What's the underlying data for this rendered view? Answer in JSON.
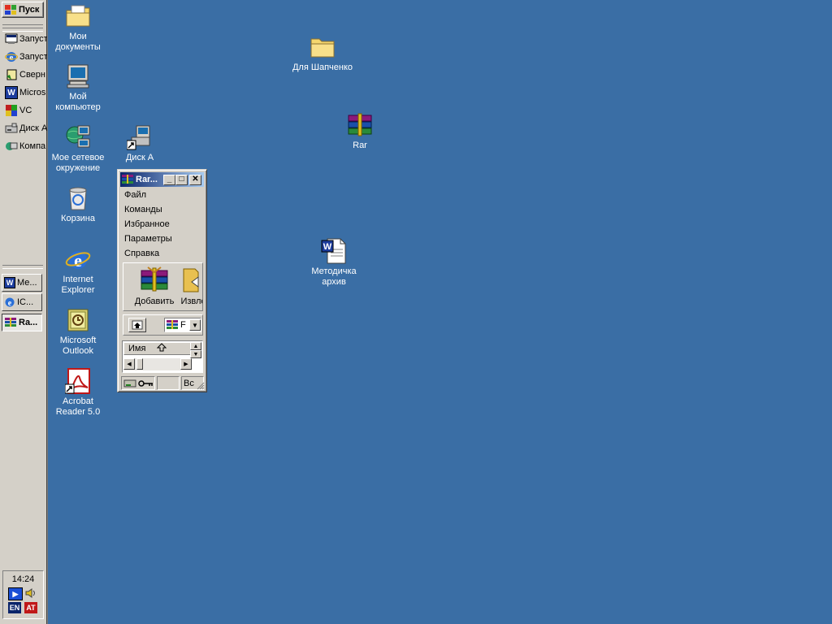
{
  "taskbar": {
    "start_label": "Пуск",
    "quick_launch": [
      {
        "label": "Запуст",
        "icon": "show-desktop-icon"
      },
      {
        "label": "Запуст",
        "icon": "internet-explorer-icon"
      },
      {
        "label": "Сверн",
        "icon": "minimize-windows-icon"
      },
      {
        "label": "Micros",
        "icon": "word-icon"
      },
      {
        "label": "VC",
        "icon": "vc-icon"
      },
      {
        "label": "Диск А",
        "icon": "floppy-icon"
      },
      {
        "label": "Компа",
        "icon": "computer-icon"
      }
    ],
    "tasks": [
      {
        "label": "Ме...",
        "icon": "word-icon",
        "active": false
      },
      {
        "label": "IC...",
        "icon": "internet-explorer-icon",
        "active": false
      },
      {
        "label": "Ra...",
        "icon": "winrar-icon",
        "active": true
      }
    ],
    "clock": "14:24",
    "tray": [
      {
        "name": "media-player-icon",
        "text": "▶"
      },
      {
        "name": "volume-icon",
        "text": "🔈"
      },
      {
        "name": "language-indicator",
        "text": "EN"
      },
      {
        "name": "ati-icon",
        "text": "AT"
      }
    ]
  },
  "desktop_icons": [
    {
      "id": "my-documents",
      "label": "Мои документы",
      "icon": "folder-documents-icon"
    },
    {
      "id": "my-computer",
      "label": "Мой компьютер",
      "icon": "computer-icon"
    },
    {
      "id": "network",
      "label": "Мое сетевое окружение",
      "icon": "network-icon"
    },
    {
      "id": "disk-a",
      "label": "Диск А",
      "icon": "floppy-shortcut-icon"
    },
    {
      "id": "recycle-bin",
      "label": "Корзина",
      "icon": "recycle-bin-icon"
    },
    {
      "id": "internet-explorer",
      "label": "Internet Explorer",
      "icon": "internet-explorer-icon"
    },
    {
      "id": "outlook",
      "label": "Microsoft Outlook",
      "icon": "outlook-icon"
    },
    {
      "id": "acrobat",
      "label": "Acrobat Reader 5.0",
      "icon": "acrobat-icon"
    },
    {
      "id": "folder-shapchenko",
      "label": "Для Шапченко",
      "icon": "folder-icon"
    },
    {
      "id": "rar",
      "label": "Rar",
      "icon": "winrar-icon"
    },
    {
      "id": "metodichka",
      "label": "Методичка архив",
      "icon": "word-document-icon"
    }
  ],
  "rar_window": {
    "title": "Rar...",
    "menu": [
      "Файл",
      "Команды",
      "Избранное",
      "Параметры",
      "Справка"
    ],
    "toolbar": [
      {
        "label": "Добавить",
        "icon": "add-archive-icon"
      },
      {
        "label": "Извле",
        "icon": "extract-icon"
      }
    ],
    "address_value": "F",
    "column_header": "Имя",
    "status_text": "Вс"
  },
  "colors": {
    "desktop": "#3a6ea5",
    "face": "#d4d0c8",
    "title_start": "#0a246a",
    "title_end": "#a6caf0"
  }
}
